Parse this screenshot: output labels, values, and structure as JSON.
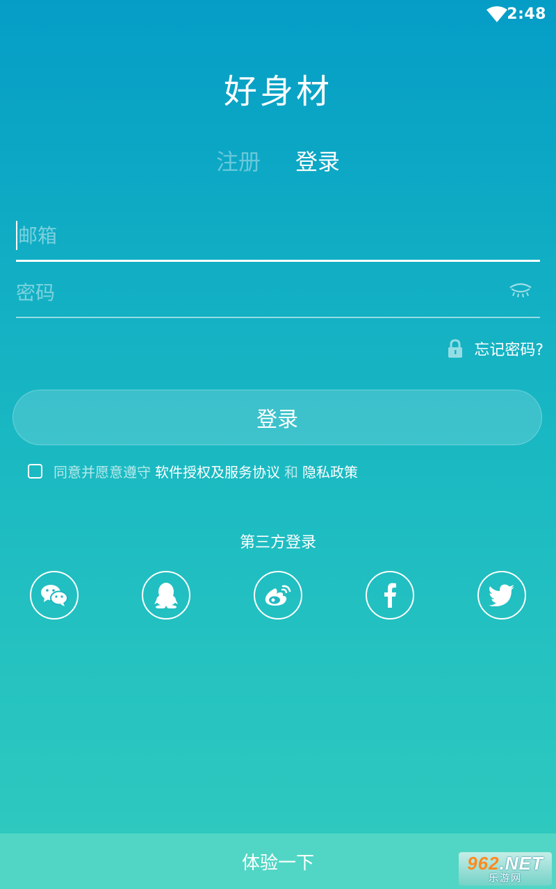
{
  "status_bar": {
    "time": "2:48",
    "wifi_icon": "wifi-icon"
  },
  "app": {
    "title": "好身材"
  },
  "tabs": [
    {
      "label": "注册",
      "active": false
    },
    {
      "label": "登录",
      "active": true
    }
  ],
  "form": {
    "email": {
      "placeholder": "邮箱",
      "value": ""
    },
    "password": {
      "placeholder": "密码",
      "value": "",
      "toggle_icon": "eye-closed-icon"
    },
    "forgot": {
      "label": "忘记密码?",
      "icon": "lock-icon"
    },
    "login_button": "登录"
  },
  "agreement": {
    "checked": false,
    "prefix": "同意并愿意遵守",
    "terms_link": "软件授权及服务协议",
    "conjunction": "和",
    "privacy_link": "隐私政策"
  },
  "third_party": {
    "title": "第三方登录",
    "providers": [
      "wechat-icon",
      "qq-icon",
      "weibo-icon",
      "facebook-icon",
      "twitter-icon"
    ]
  },
  "footer": {
    "try_label": "体验一下"
  },
  "watermark": {
    "big": "962",
    "suffix": ".NET",
    "small": "乐游网"
  },
  "colors": {
    "gradient_top": "#059dc6",
    "gradient_bottom": "#31cbbe",
    "footer_bar": "#51d6c5",
    "accent": "#ffffff"
  }
}
